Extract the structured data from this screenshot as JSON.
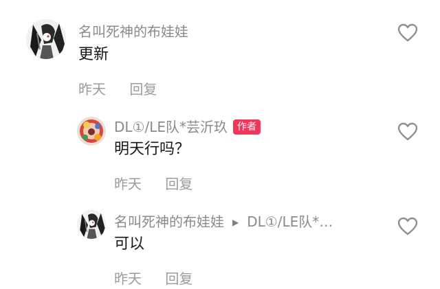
{
  "comments": [
    {
      "username": "名叫死神的布娃娃",
      "text": "更新",
      "time": "昨天",
      "reply_label": "回复",
      "avatar_icon": "anime-avatar-icon"
    },
    {
      "username": "DL①/LE队*芸沂玖",
      "badge": "作者",
      "text": "明天行吗？",
      "time": "昨天",
      "reply_label": "回复",
      "avatar_icon": "anime-avatar-icon"
    },
    {
      "username": "名叫死神的布娃娃",
      "reply_to": "DL①/LE队*…",
      "text": "可以",
      "time": "昨天",
      "reply_label": "回复",
      "avatar_icon": "anime-avatar-icon"
    }
  ],
  "colors": {
    "accent": "#f2365a",
    "muted_text": "#8a8a8a",
    "body_text": "#161616"
  }
}
